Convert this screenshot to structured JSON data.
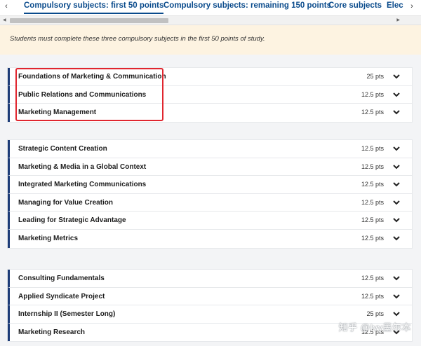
{
  "tabs": [
    {
      "label": "Compulsory subjects: first 50 points",
      "active": true
    },
    {
      "label": "Compulsory subjects: remaining 150 points",
      "active": false
    },
    {
      "label": "Core subjects",
      "active": false
    },
    {
      "label": "Elec",
      "active": false
    }
  ],
  "notice": {
    "text": "Students must complete these three compulsory subjects in the first 50 points of study."
  },
  "groups": [
    {
      "rows": [
        {
          "title": "Foundations of Marketing & Communication",
          "pts": "25 pts"
        },
        {
          "title": "Public Relations and Communications",
          "pts": "12.5 pts"
        },
        {
          "title": "Marketing Management",
          "pts": "12.5 pts"
        }
      ]
    },
    {
      "rows": [
        {
          "title": "Strategic Content Creation",
          "pts": "12.5 pts"
        },
        {
          "title": "Marketing & Media in a Global Context",
          "pts": "12.5 pts"
        },
        {
          "title": "Integrated Marketing Communications",
          "pts": "12.5 pts"
        },
        {
          "title": "Managing for Value Creation",
          "pts": "12.5 pts"
        },
        {
          "title": "Leading for Strategic Advantage",
          "pts": "12.5 pts"
        },
        {
          "title": "Marketing Metrics",
          "pts": "12.5 pts"
        }
      ]
    },
    {
      "rows": [
        {
          "title": "Consulting Fundamentals",
          "pts": "12.5 pts"
        },
        {
          "title": "Applied Syndicate Project",
          "pts": "12.5 pts"
        },
        {
          "title": "Internship II (Semester Long)",
          "pts": "25 pts"
        },
        {
          "title": "Marketing Research",
          "pts": "12.5 pts"
        }
      ]
    }
  ],
  "watermark": "知乎 @Ivy墨尔本",
  "icons": {
    "tab_prev": "chevron-left-icon",
    "tab_next": "chevron-right-icon",
    "row_expand": "chevron-down-icon"
  },
  "colors": {
    "tab_text": "#0a4b8c",
    "row_accent": "#1d3c78",
    "notice_bg": "#fdf3e1",
    "highlight": "#e0262f"
  }
}
